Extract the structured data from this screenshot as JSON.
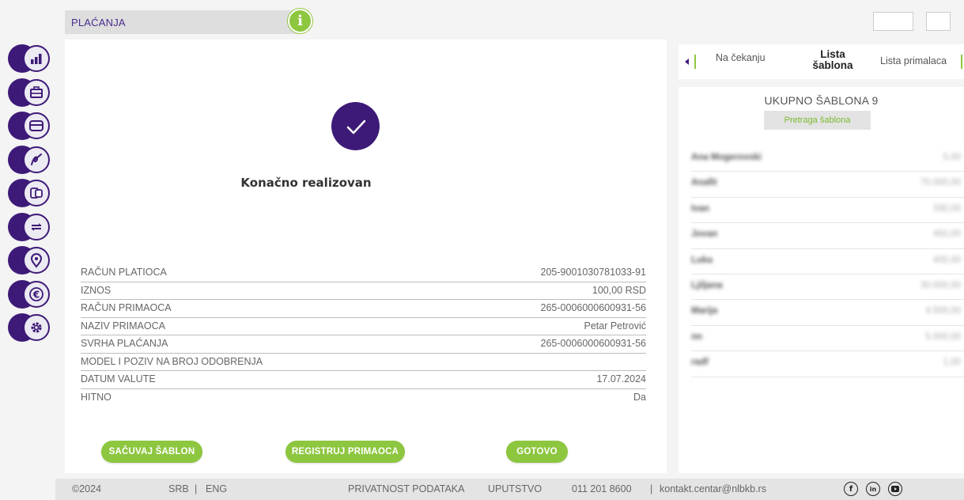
{
  "header": {
    "section_title": "PLAĆANJA",
    "info_icon": "info-icon",
    "accent_color": "#8dc63f",
    "brand_color": "#3d1a78"
  },
  "sidebar": {
    "items": [
      {
        "icon": "chart-icon"
      },
      {
        "icon": "briefcase-icon"
      },
      {
        "icon": "card-icon"
      },
      {
        "icon": "signature-icon"
      },
      {
        "icon": "exchange-icon"
      },
      {
        "icon": "transfer-icon"
      },
      {
        "icon": "location-icon"
      },
      {
        "icon": "euro-icon"
      },
      {
        "icon": "settings-icon"
      }
    ]
  },
  "main": {
    "status_title": "Konačno realizovan",
    "details": [
      {
        "label": "RAČUN PLATIOCA",
        "value": "205-9001030781033-91"
      },
      {
        "label": "IZNOS",
        "value": "100,00 RSD"
      },
      {
        "label": "RAČUN PRIMAOCA",
        "value": "265-0006000600931-56"
      },
      {
        "label": "NAZIV PRIMAOCA",
        "value": "Petar Petrović"
      },
      {
        "label": "SVRHA PLAĆANJA",
        "value": "265-0006000600931-56"
      },
      {
        "label": "MODEL I POZIV NA BROJ ODOBRENJA",
        "value": ""
      },
      {
        "label": "DATUM VALUTE",
        "value": "17.07.2024"
      },
      {
        "label": "HITNO",
        "value": "Da"
      }
    ],
    "buttons": {
      "save_template": "SAČUVAJ ŠABLON",
      "register_recipient": "REGISTRUJ PRIMAOCA",
      "done": "GOTOVO"
    }
  },
  "right_panel": {
    "tabs": {
      "pending": "Na čekanju",
      "templates_line1": "Lista",
      "templates_line2": "šablona",
      "recipients": "Lista primalaca"
    },
    "total": "UKUPNO ŠABLONA 9",
    "search_button": "Pretraga šablona",
    "templates": [
      {
        "name": "Ana Mogerovski",
        "amount": "5,00"
      },
      {
        "name": "Anafit",
        "amount": "70.000,00"
      },
      {
        "name": "Ivan",
        "amount": "330,00"
      },
      {
        "name": "Jovan",
        "amount": "450,00"
      },
      {
        "name": "Luka",
        "amount": "400,00"
      },
      {
        "name": "Ljiljana",
        "amount": "30.000,00"
      },
      {
        "name": "Marija",
        "amount": "4.500,00"
      },
      {
        "name": "nn",
        "amount": "5.000,00"
      },
      {
        "name": "radf",
        "amount": "1,00"
      }
    ]
  },
  "footer": {
    "copyright": "©2024",
    "lang_srb": "SRB",
    "lang_sep": "|",
    "lang_eng": "ENG",
    "privacy": "PRIVATNOST PODATAKA",
    "guide": "UPUTSTVO",
    "phone": "011 201 8600",
    "contact_sep": "|",
    "email": "kontakt.centar@nlbkb.rs",
    "social": [
      "facebook-icon",
      "linkedin-icon",
      "youtube-icon"
    ]
  }
}
